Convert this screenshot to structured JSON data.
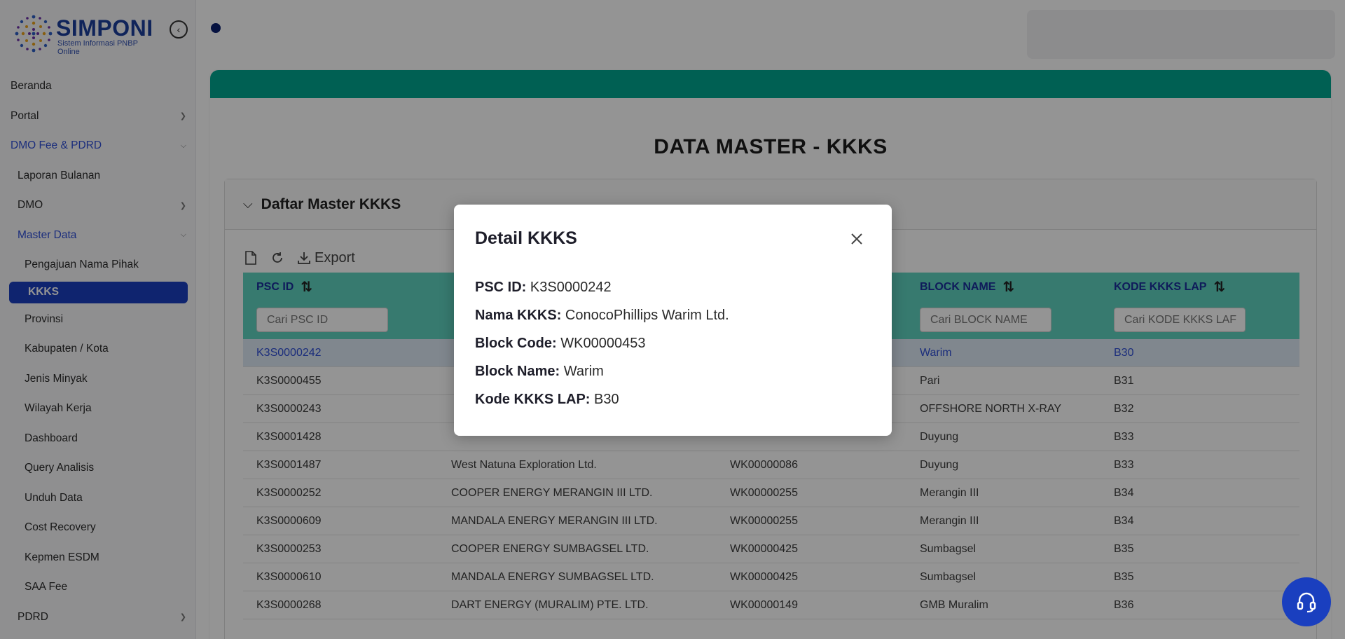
{
  "brand": {
    "name": "SIMPONI",
    "subtitle": "Sistem Informasi PNBP Online"
  },
  "sidebar": {
    "items": [
      {
        "label": "Beranda"
      },
      {
        "label": "Portal"
      },
      {
        "label": "DMO Fee & PDRD"
      },
      {
        "label": "Laporan Bulanan"
      },
      {
        "label": "DMO"
      },
      {
        "label": "Master Data"
      },
      {
        "label": "Pengajuan Nama Pihak"
      },
      {
        "label": "KKKS"
      },
      {
        "label": "Provinsi"
      },
      {
        "label": "Kabupaten / Kota"
      },
      {
        "label": "Jenis Minyak"
      },
      {
        "label": "Wilayah Kerja"
      },
      {
        "label": "Dashboard"
      },
      {
        "label": "Query Analisis"
      },
      {
        "label": "Unduh Data"
      },
      {
        "label": "Cost Recovery"
      },
      {
        "label": "Kepmen ESDM"
      },
      {
        "label": "SAA Fee"
      },
      {
        "label": "PDRD"
      }
    ]
  },
  "page": {
    "title": "DATA MASTER - KKKS",
    "section_title": "Daftar Master KKKS",
    "export_label": "Export"
  },
  "table": {
    "headers": [
      "PSC ID",
      "BLOCK NAME",
      "KODE KKKS LAP"
    ],
    "filters": [
      "Cari PSC ID",
      "Cari BLOCK NAME",
      "Cari KODE KKKS LAF"
    ],
    "rows": [
      [
        "K3S0000242",
        "",
        "",
        "Warim",
        "B30"
      ],
      [
        "K3S0000455",
        "",
        "",
        "Pari",
        "B31"
      ],
      [
        "K3S0000243",
        "",
        "",
        "OFFSHORE NORTH X-RAY",
        "B32"
      ],
      [
        "K3S0001428",
        "",
        "",
        "Duyung",
        "B33"
      ],
      [
        "K3S0001487",
        "West Natuna Exploration Ltd.",
        "WK00000086",
        "Duyung",
        "B33"
      ],
      [
        "K3S0000252",
        "COOPER ENERGY MERANGIN III LTD.",
        "WK00000255",
        "Merangin III",
        "B34"
      ],
      [
        "K3S0000609",
        "MANDALA ENERGY MERANGIN III LTD.",
        "WK00000255",
        "Merangin III",
        "B34"
      ],
      [
        "K3S0000253",
        "COOPER ENERGY SUMBAGSEL LTD.",
        "WK00000425",
        "Sumbagsel",
        "B35"
      ],
      [
        "K3S0000610",
        "MANDALA ENERGY SUMBAGSEL LTD.",
        "WK00000425",
        "Sumbagsel",
        "B35"
      ],
      [
        "K3S0000268",
        "DART ENERGY (MURALIM) PTE. LTD.",
        "WK00000149",
        "GMB Muralim",
        "B36"
      ]
    ]
  },
  "modal": {
    "title": "Detail KKKS",
    "fields": [
      {
        "label": "PSC ID:",
        "value": "K3S0000242"
      },
      {
        "label": "Nama KKKS:",
        "value": "ConocoPhillips Warim Ltd."
      },
      {
        "label": "Block Code:",
        "value": "WK00000453"
      },
      {
        "label": "Block Name:",
        "value": "Warim"
      },
      {
        "label": "Kode KKKS LAP:",
        "value": "B30"
      }
    ]
  }
}
